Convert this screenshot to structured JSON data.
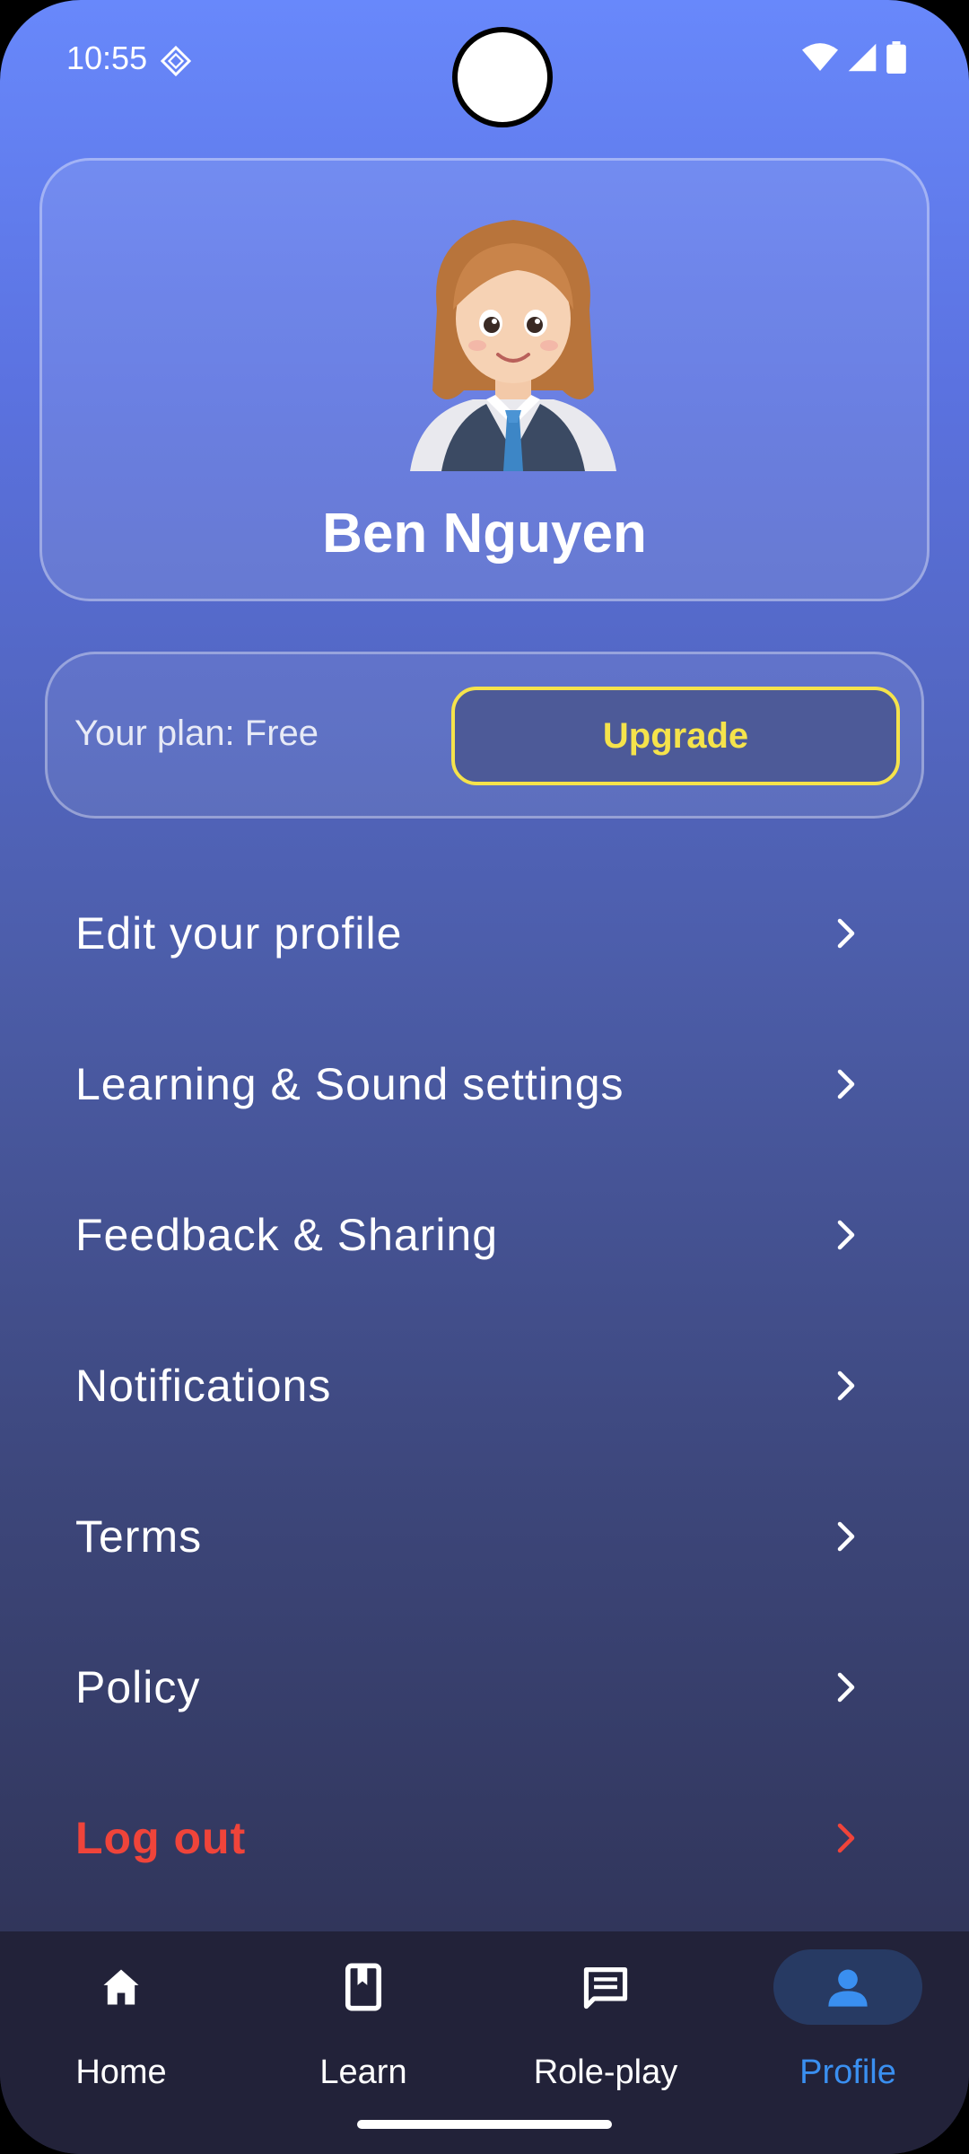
{
  "status_bar": {
    "time": "10:55",
    "icons": [
      "sparkle-diamond-icon",
      "wifi-icon",
      "signal-icon",
      "battery-icon"
    ]
  },
  "profile": {
    "name": "Ben Nguyen",
    "avatar": "avatar-3d-girl"
  },
  "plan": {
    "label": "Your plan: Free",
    "upgrade_label": "Upgrade",
    "accent": "#f5e34b"
  },
  "menu": {
    "items": [
      {
        "label": "Edit your profile"
      },
      {
        "label": "Learning & Sound settings"
      },
      {
        "label": "Feedback & Sharing"
      },
      {
        "label": "Notifications"
      },
      {
        "label": "Terms"
      },
      {
        "label": "Policy"
      }
    ],
    "logout": {
      "label": "Log out",
      "color": "#f0443a"
    }
  },
  "bottom_nav": {
    "items": [
      {
        "label": "Home",
        "icon": "home-icon"
      },
      {
        "label": "Learn",
        "icon": "book-icon"
      },
      {
        "label": "Role-play",
        "icon": "chat-icon"
      },
      {
        "label": "Profile",
        "icon": "person-icon",
        "active": true
      }
    ],
    "active_color": "#3a8ff0"
  }
}
